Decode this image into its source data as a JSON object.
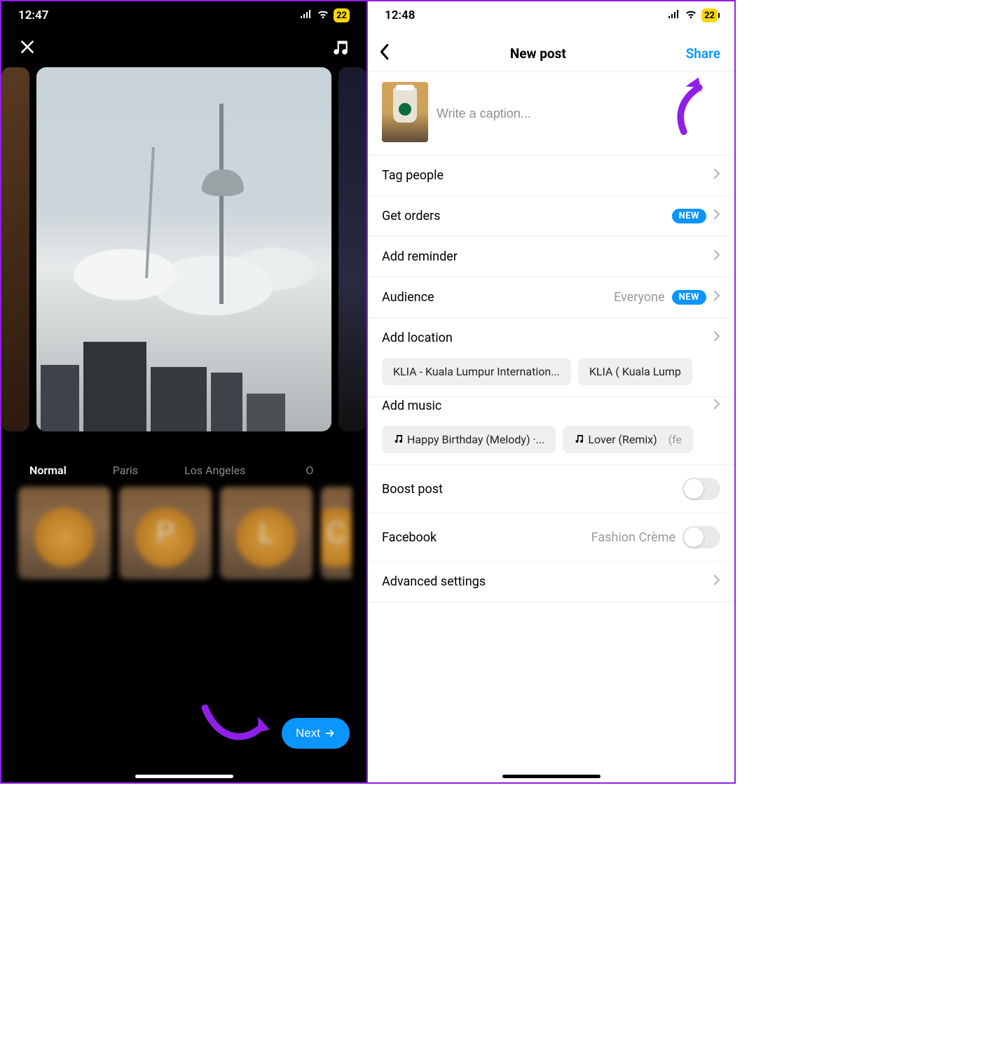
{
  "left": {
    "time": "12:47",
    "battery": "22",
    "filters": [
      "Normal",
      "Paris",
      "Los Angeles",
      "O"
    ],
    "filter_letters": [
      "",
      "P",
      "L",
      "C"
    ],
    "next_label": "Next"
  },
  "right": {
    "time": "12:48",
    "battery": "22",
    "title": "New post",
    "share_label": "Share",
    "caption_placeholder": "Write a caption...",
    "rows": {
      "tag_people": "Tag people",
      "get_orders": "Get orders",
      "add_reminder": "Add reminder",
      "audience": "Audience",
      "audience_value": "Everyone",
      "add_location": "Add location",
      "add_music": "Add music",
      "boost_post": "Boost post",
      "facebook": "Facebook",
      "facebook_value": "Fashion Crème",
      "advanced": "Advanced settings"
    },
    "new_badge": "NEW",
    "location_chips": [
      "KLIA - Kuala Lumpur Internation...",
      "KLIA ( Kuala Lump"
    ],
    "music_chips": [
      {
        "title": "Happy Birthday (Melody) ·...",
        "extra": ""
      },
      {
        "title": "Lover (Remix)",
        "extra": "(fe"
      }
    ]
  }
}
